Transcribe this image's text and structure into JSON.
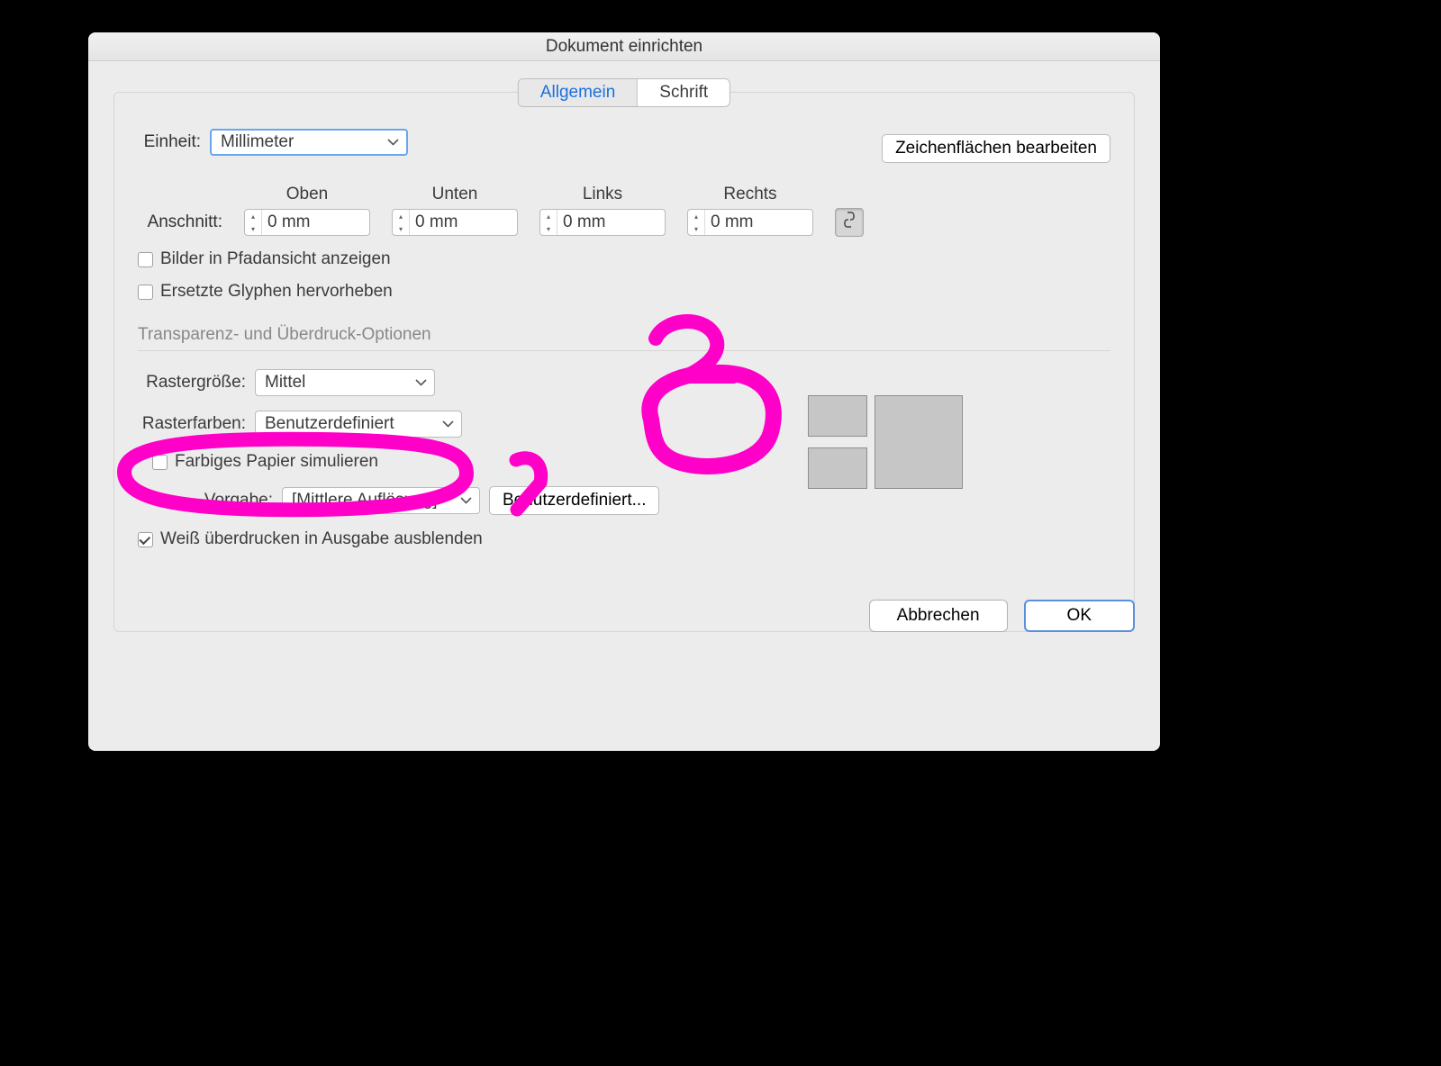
{
  "dialog": {
    "title": "Dokument einrichten"
  },
  "tabs": {
    "general": "Allgemein",
    "type": "Schrift"
  },
  "unit": {
    "label": "Einheit:",
    "value": "Millimeter"
  },
  "editArtboards": "Zeichenflächen bearbeiten",
  "bleed": {
    "label": "Anschnitt:",
    "headers": {
      "top": "Oben",
      "bottom": "Unten",
      "left": "Links",
      "right": "Rechts"
    },
    "values": {
      "top": "0 mm",
      "bottom": "0 mm",
      "left": "0 mm",
      "right": "0 mm"
    }
  },
  "cb": {
    "outlineImages": "Bilder in Pfadansicht anzeigen",
    "highlightGlyphs": "Ersetzte Glyphen hervorheben",
    "simulatePaper": "Farbiges Papier simulieren",
    "overprintWhite": "Weiß überdrucken in Ausgabe ausblenden"
  },
  "section": {
    "transparency": "Transparenz- und Überdruck-Optionen"
  },
  "raster": {
    "sizeLabel": "Rastergröße:",
    "sizeValue": "Mittel",
    "colorsLabel": "Rasterfarben:",
    "colorsValue": "Benutzerdefiniert",
    "presetLabel": "Vorgabe:",
    "presetValue": "[Mittlere Auflösung]",
    "customBtn": "Benutzerdefiniert..."
  },
  "footer": {
    "cancel": "Abbrechen",
    "ok": "OK"
  },
  "annotations": {
    "one": "1",
    "two": "2"
  }
}
